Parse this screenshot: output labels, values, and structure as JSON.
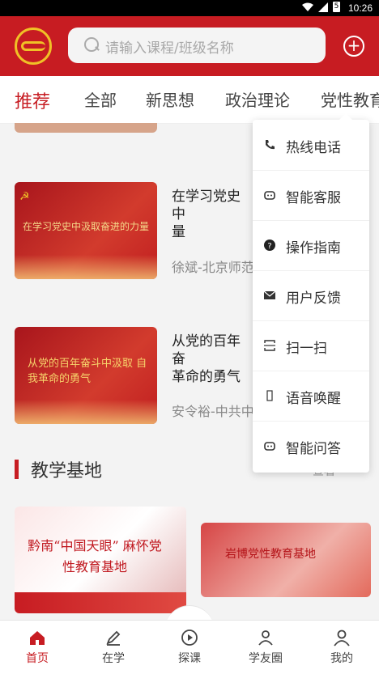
{
  "status_bar": {
    "time": "10:26",
    "battery": "5"
  },
  "header": {
    "search_placeholder": "请输入课程/班级名称"
  },
  "tabs": [
    "推荐",
    "全部",
    "新思想",
    "政治理论",
    "党性教育"
  ],
  "courses": [
    {
      "thumb_text": "在学习党史中汲取奋进的力量",
      "title": "在学习党史中汲取奋进的力量",
      "title_visible": "在学习党史中\n量",
      "teacher": "徐斌-北京师范"
    },
    {
      "thumb_text": "从党的百年奋斗中汲取 自我革命的勇气",
      "title_visible": "从党的百年奋\n革命的勇气",
      "teacher": "安令裕-中共中"
    }
  ],
  "section": {
    "title": "教学基地",
    "more_partial": "查看"
  },
  "bases": [
    {
      "caption": "黔南“中国天眼” 麻怀党性教育基地"
    },
    {
      "caption": "岩博党性教育基地"
    }
  ],
  "menu": {
    "items": [
      {
        "label": "热线电话",
        "icon": "phone-icon"
      },
      {
        "label": "智能客服",
        "icon": "robot-icon"
      },
      {
        "label": "操作指南",
        "icon": "question-icon"
      },
      {
        "label": "用户反馈",
        "icon": "mail-icon"
      },
      {
        "label": "扫一扫",
        "icon": "scan-icon"
      },
      {
        "label": "语音唤醒",
        "icon": "voice-icon"
      },
      {
        "label": "智能问答",
        "icon": "chat-robot-icon"
      }
    ]
  },
  "bottom_nav": [
    {
      "label": "首页",
      "icon": "home-icon"
    },
    {
      "label": "在学",
      "icon": "pencil-icon"
    },
    {
      "label": "探课",
      "icon": "play-icon"
    },
    {
      "label": "学友圈",
      "icon": "friends-icon"
    },
    {
      "label": "我的",
      "icon": "user-icon"
    }
  ],
  "colors": {
    "brand_red": "#c71c22",
    "gold": "#f0c126"
  }
}
